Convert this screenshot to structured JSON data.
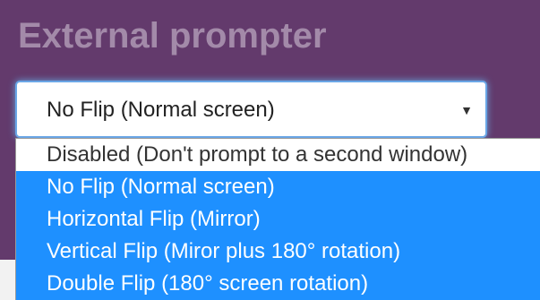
{
  "section": {
    "title": "External prompter"
  },
  "flip_select": {
    "selected": "No Flip (Normal screen)",
    "caret": "▼",
    "options": [
      "Disabled (Don't prompt to a second window)",
      "No Flip (Normal screen)",
      "Horizontal Flip (Mirror)",
      "Vertical Flip (Miror plus 180° rotation)",
      "Double Flip (180° screen rotation)"
    ]
  },
  "colors": {
    "panel_background": "#633a6c",
    "heading_text": "#a38aa9",
    "dropdown_highlight": "#1e90ff",
    "focus_border": "#6aa6e6"
  }
}
